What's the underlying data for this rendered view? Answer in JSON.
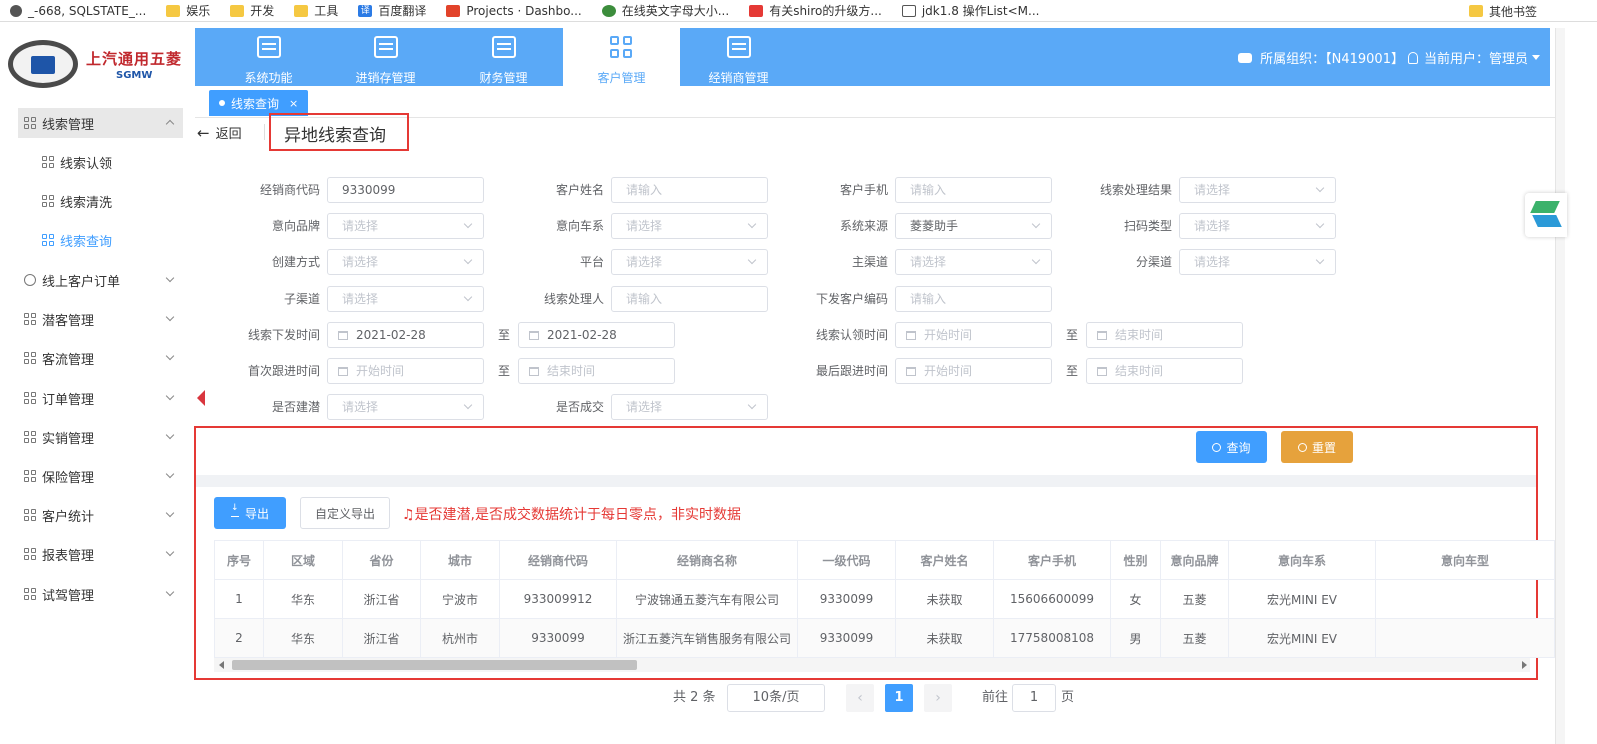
{
  "bookmarks": [
    {
      "icon": "globe-icon",
      "label": "_-668, SQLSTATE_..."
    },
    {
      "icon": "folder-icon",
      "label": "娱乐"
    },
    {
      "icon": "folder-icon",
      "label": "开发"
    },
    {
      "icon": "folder-icon",
      "label": "工具"
    },
    {
      "icon": "translate-icon",
      "label": "百度翻译"
    },
    {
      "icon": "gitlab-icon",
      "label": "Projects · Dashbo..."
    },
    {
      "icon": "frog-icon",
      "label": "在线英文字母大小..."
    },
    {
      "icon": "csdn-icon",
      "label": "有关shiro的升级方..."
    },
    {
      "icon": "java-icon",
      "label": "jdk1.8 操作List<M..."
    }
  ],
  "bookmarks_other": "其他书签",
  "logo": {
    "text": "上汽通用五菱",
    "sub": "SGMW"
  },
  "sidebar": {
    "items": [
      {
        "label": "线索管理",
        "expanded": true
      },
      {
        "label": "线索认领"
      },
      {
        "label": "线索清洗"
      },
      {
        "label": "线索查询"
      },
      {
        "label": "线上客户订单"
      },
      {
        "label": "潜客管理"
      },
      {
        "label": "客流管理"
      },
      {
        "label": "订单管理"
      },
      {
        "label": "实销管理"
      },
      {
        "label": "保险管理"
      },
      {
        "label": "客户统计"
      },
      {
        "label": "报表管理"
      },
      {
        "label": "试驾管理"
      }
    ]
  },
  "topnav": {
    "items": [
      {
        "label": "系统功能"
      },
      {
        "label": "进销存管理"
      },
      {
        "label": "财务管理"
      },
      {
        "label": "客户管理"
      },
      {
        "label": "经销商管理"
      }
    ],
    "org": "所属组织：【N419001】",
    "user": "当前用户：管理员"
  },
  "tab": {
    "label": "线索查询",
    "close": "×"
  },
  "header": {
    "back": "返回",
    "title": "异地线索查询"
  },
  "form": {
    "dealer_code_label": "经销商代码",
    "dealer_code": "9330099",
    "cust_name_label": "客户姓名",
    "cust_name_ph": "请输入",
    "cust_phone_label": "客户手机",
    "cust_phone_ph": "请输入",
    "result_label": "线索处理结果",
    "result_ph": "请选择",
    "brand_label": "意向品牌",
    "brand_ph": "请选择",
    "series_label": "意向车系",
    "series_ph": "请选择",
    "source_label": "系统来源",
    "source": "菱菱助手",
    "scan_label": "扫码类型",
    "scan_ph": "请选择",
    "create_label": "创建方式",
    "create_ph": "请选择",
    "platform_label": "平台",
    "platform_ph": "请选择",
    "main_ch_label": "主渠道",
    "main_ch_ph": "请选择",
    "sub_ch_label": "分渠道",
    "sub_ch_ph": "请选择",
    "child_ch_label": "子渠道",
    "child_ch_ph": "请选择",
    "handler_label": "线索处理人",
    "handler_ph": "请输入",
    "issue_code_label": "下发客户编码",
    "issue_code_ph": "请输入",
    "issue_time_label": "线索下发时间",
    "issue_from": "2021-02-28",
    "issue_to": "2021-02-28",
    "claim_time_label": "线索认领时间",
    "first_follow_label": "首次跟进时间",
    "last_follow_label": "最后跟进时间",
    "start_ph": "开始时间",
    "end_ph": "结束时间",
    "to": "至",
    "latent_label": "是否建潜",
    "latent_ph": "请选择",
    "deal_label": "是否成交",
    "deal_ph": "请选择"
  },
  "actions": {
    "query": "查询",
    "reset": "重置",
    "export": "导出",
    "custom_export": "自定义导出"
  },
  "notice": "是否建潜,是否成交数据统计于每日零点，非实时数据",
  "table": {
    "columns": [
      "序号",
      "区域",
      "省份",
      "城市",
      "经销商代码",
      "经销商名称",
      "一级代码",
      "客户姓名",
      "客户手机",
      "性别",
      "意向品牌",
      "意向车系",
      "意向车型"
    ],
    "rows": [
      [
        "1",
        "华东",
        "浙江省",
        "宁波市",
        "933009912",
        "宁波锦通五菱汽车有限公司",
        "9330099",
        "未获取",
        "15606600099",
        "女",
        "五菱",
        "宏光MINI EV",
        ""
      ],
      [
        "2",
        "华东",
        "浙江省",
        "杭州市",
        "9330099",
        "浙江五菱汽车销售服务有限公司",
        "9330099",
        "未获取",
        "17758008108",
        "男",
        "五菱",
        "宏光MINI EV",
        ""
      ]
    ]
  },
  "pagination": {
    "total": "共 2 条",
    "size": "10条/页",
    "current": "1",
    "goto": "前往",
    "goto_val": "1",
    "page": "页"
  },
  "colors": {
    "primary": "#409eff",
    "nav": "#5aa9f7",
    "warning": "#e6a23c",
    "highlight": "#e53935"
  }
}
